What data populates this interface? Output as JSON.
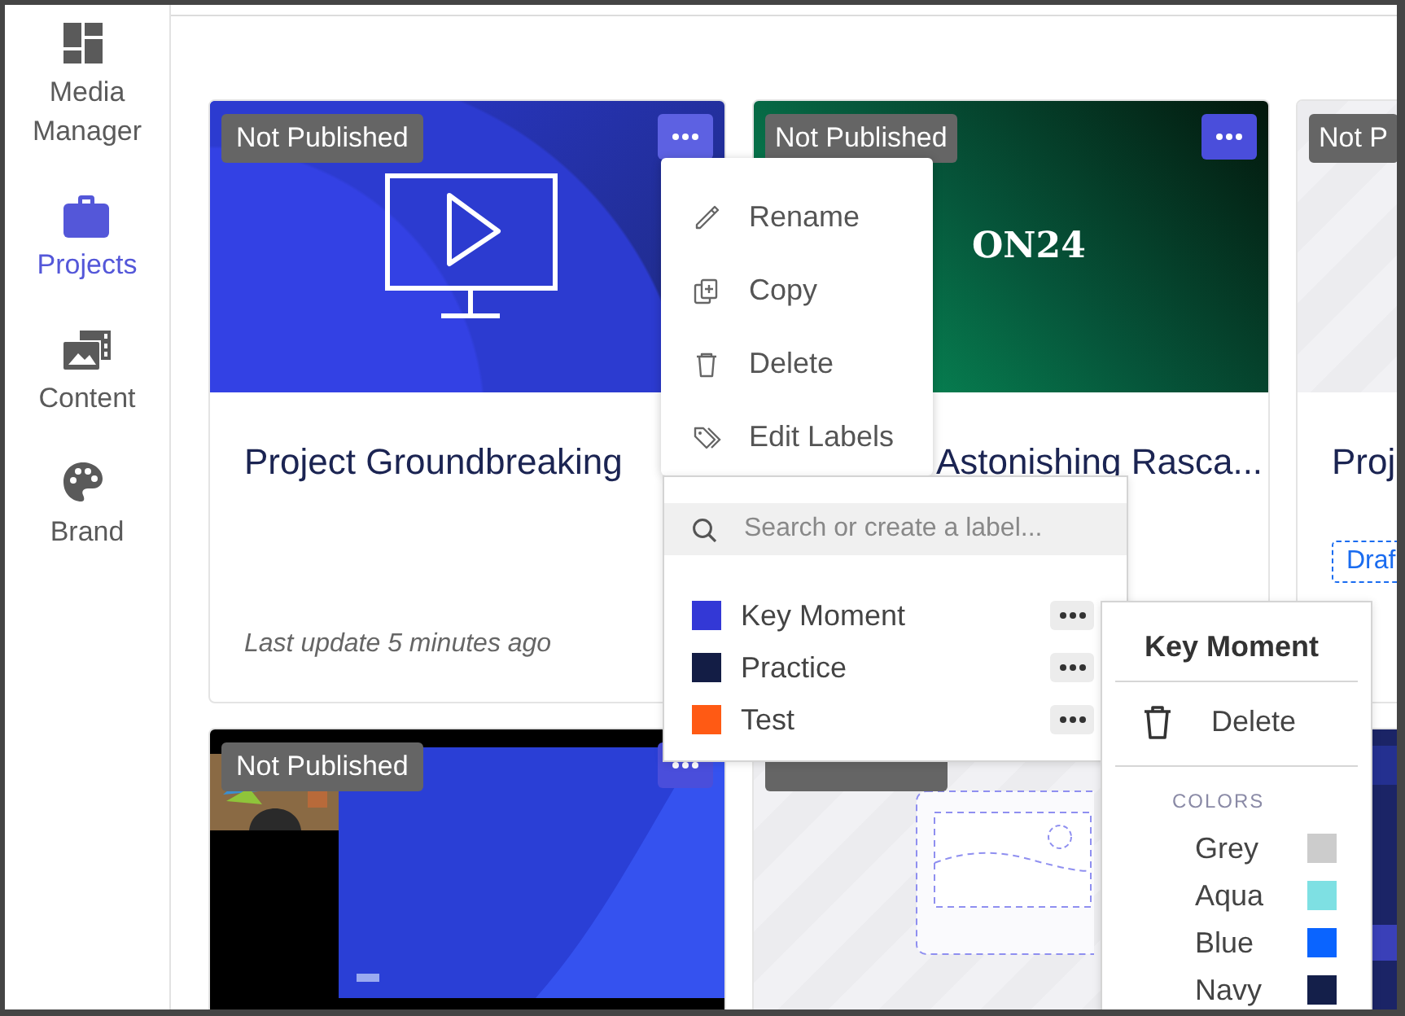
{
  "sidebar": {
    "items": [
      {
        "label": "Media Manager",
        "selected": false
      },
      {
        "label": "Projects",
        "selected": true
      },
      {
        "label": "Content",
        "selected": false
      },
      {
        "label": "Brand",
        "selected": false
      }
    ]
  },
  "projects": [
    {
      "kind": "monitor",
      "status": "Not Published",
      "menu_open": true,
      "title": "Project Groundbreaking",
      "updated": "Last update 5 minutes ago"
    },
    {
      "kind": "logo",
      "logo_text": "ON24",
      "status": "Not Published",
      "menu_open": false,
      "title": "Astonishing Rasca..."
    },
    {
      "kind": "stripes",
      "status": "Not P",
      "title": "Proj",
      "tag": "Draf"
    },
    {
      "kind": "video",
      "status": "Not Published",
      "menu_open": false
    },
    {
      "kind": "placeholder",
      "covered_badge": true
    },
    {
      "kind": "slide"
    }
  ],
  "card_menu": {
    "items": [
      {
        "label": "Rename"
      },
      {
        "label": "Copy"
      },
      {
        "label": "Delete"
      },
      {
        "label": "Edit Labels"
      }
    ]
  },
  "label_picker": {
    "search": {
      "placeholder": "Search or create a label..."
    },
    "labels": [
      {
        "name": "Key Moment",
        "color": "#3338d6"
      },
      {
        "name": "Practice",
        "color": "#131d45"
      },
      {
        "name": "Test",
        "color": "#ff5a14"
      }
    ]
  },
  "label_options": {
    "title": "Key Moment",
    "actions": [
      {
        "label": "Delete"
      }
    ],
    "colors_heading": "COLORS",
    "colors": [
      {
        "name": "Grey",
        "color": "#cccccc"
      },
      {
        "name": "Aqua",
        "color": "#7ee0e3"
      },
      {
        "name": "Blue",
        "color": "#0a64ff"
      },
      {
        "name": "Navy",
        "color": "#141f4a"
      }
    ]
  }
}
